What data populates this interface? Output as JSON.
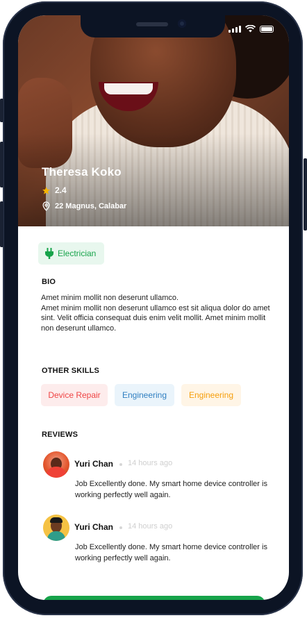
{
  "profile": {
    "name": "Theresa Koko",
    "rating": "2.4",
    "location": "22 Magnus, Calabar",
    "profession": "Electrician"
  },
  "bio": {
    "title": "BIO",
    "text": "Amet minim mollit non deserunt ullamco.\nAmet minim mollit non deserunt ullamco est sit aliqua dolor do amet sint. Velit officia consequat duis enim velit mollit. Amet minim mollit non deserunt ullamco."
  },
  "skills": {
    "title": "OTHER SKILLS",
    "items": [
      {
        "label": "Device Repair",
        "color": "#ef4444",
        "bg": "#fdecec"
      },
      {
        "label": "Engineering",
        "color": "#2f7fc1",
        "bg": "#eaf4fb"
      },
      {
        "label": "Engineering",
        "color": "#f59e0b",
        "bg": "#fff5e6"
      }
    ]
  },
  "reviews": {
    "title": "REVIEWS",
    "items": [
      {
        "name": "Yuri Chan",
        "time": "14 hours ago",
        "text": "Job Excellently done. My smart home device controller is working perfectly well again."
      },
      {
        "name": "Yuri Chan",
        "time": "14 hours ago",
        "text": "Job Excellently done. My smart home device controller is working perfectly well again."
      }
    ]
  },
  "colors": {
    "accent": "#16a34a",
    "star": "#f5b300"
  },
  "icons": [
    "star-icon",
    "location-pin-icon",
    "plug-icon",
    "signal-icon",
    "wifi-icon",
    "battery-icon"
  ]
}
